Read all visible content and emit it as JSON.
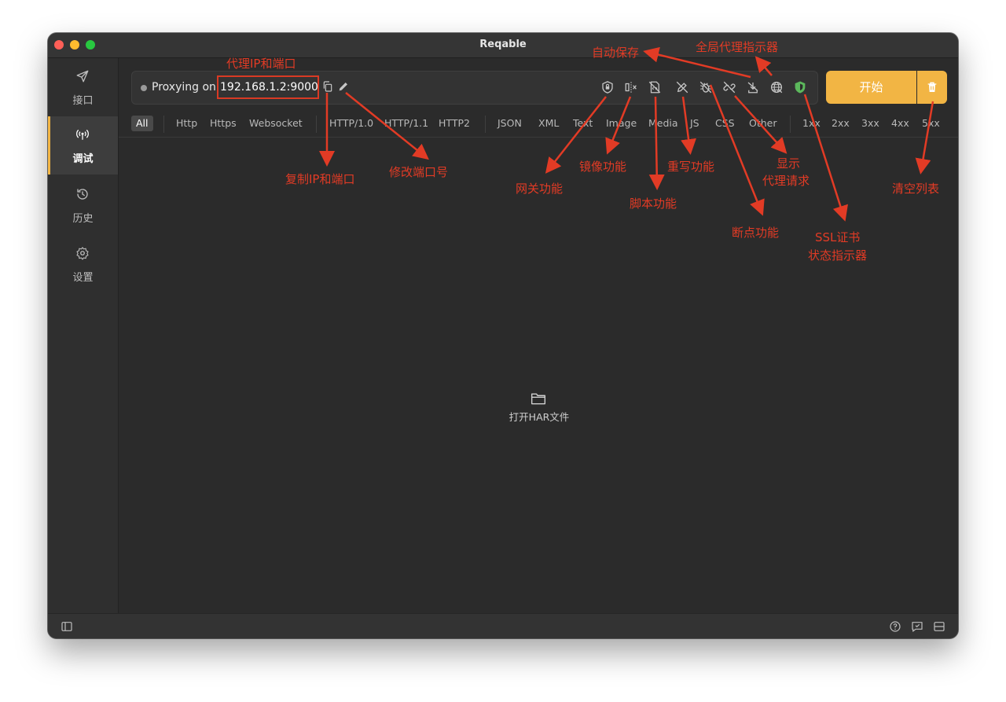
{
  "window": {
    "title": "Reqable"
  },
  "sidebar": {
    "items": [
      {
        "label": "接口",
        "icon": "send-icon"
      },
      {
        "label": "调试",
        "icon": "broadcast-icon",
        "active": true
      },
      {
        "label": "历史",
        "icon": "history-icon"
      },
      {
        "label": "设置",
        "icon": "gear-icon"
      }
    ]
  },
  "proxy": {
    "status_text": "Proxying on",
    "address": "192.168.1.2:9000"
  },
  "toolbar": {
    "icons": [
      "copy-icon",
      "edit-icon",
      "gateway-icon",
      "mirror-icon",
      "script-icon",
      "rewrite-icon",
      "breakpoint-icon",
      "show-proxy-requests-icon",
      "auto-save-icon",
      "global-proxy-icon",
      "ssl-shield-icon"
    ],
    "start_label": "开始",
    "clear_icon": "trash-icon",
    "ssl_color": "#5cb85c",
    "accent": "#f2b544"
  },
  "filters": {
    "groups": [
      [
        "All"
      ],
      [
        "Http",
        "Https",
        "Websocket"
      ],
      [
        "HTTP/1.0",
        "HTTP/1.1",
        "HTTP2"
      ],
      [
        "JSON",
        "XML",
        "Text",
        "Image",
        "Media",
        "JS",
        "CSS",
        "Other"
      ],
      [
        "1xx",
        "2xx",
        "3xx",
        "4xx",
        "5xx"
      ]
    ],
    "active": "All"
  },
  "empty_state": {
    "icon": "folder-icon",
    "label": "打开HAR文件"
  },
  "statusbar": {
    "icons": [
      "sidebar-toggle-icon",
      "help-icon",
      "feedback-icon",
      "layout-icon"
    ]
  },
  "annotations": {
    "proxy_ip_port": "代理IP和端口",
    "copy_ip_port": "复制IP和端口",
    "edit_port": "修改端口号",
    "gateway": "网关功能",
    "mirror": "镜像功能",
    "script": "脚本功能",
    "rewrite": "重写功能",
    "breakpoint": "断点功能",
    "auto_save": "自动保存",
    "global_proxy": "全局代理指示器",
    "show_proxy_line1": "显示",
    "show_proxy_line2": "代理请求",
    "ssl_line1": "SSL证书",
    "ssl_line2": "状态指示器",
    "clear_list": "清空列表",
    "color": "#e23b25"
  }
}
